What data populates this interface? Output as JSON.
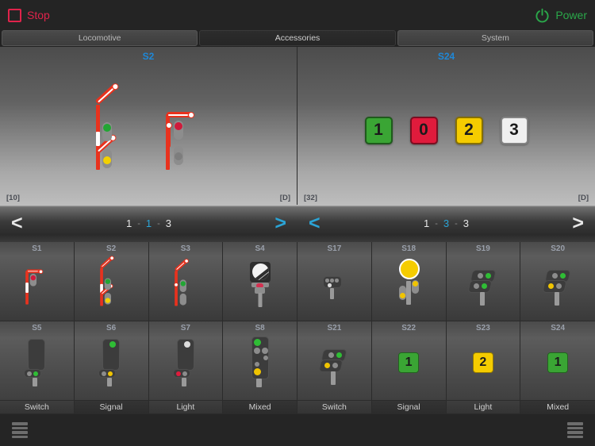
{
  "topbar": {
    "stop_label": "Stop",
    "power_label": "Power",
    "stop_color": "#e0234b",
    "power_color": "#2aa84a"
  },
  "tabs": [
    {
      "label": "Locomotive",
      "active": false
    },
    {
      "label": "Accessories",
      "active": true
    },
    {
      "label": "System",
      "active": false
    }
  ],
  "panels": [
    {
      "title": "S2",
      "corner_left": "[10]",
      "corner_right": "[D]",
      "type": "semaphore"
    },
    {
      "title": "S24",
      "corner_left": "[32]",
      "corner_right": "[D]",
      "type": "plates",
      "plates": [
        {
          "value": "1",
          "color": "#3aa534"
        },
        {
          "value": "0",
          "color": "#e01b3c"
        },
        {
          "value": "2",
          "color": "#f5cc00"
        },
        {
          "value": "3",
          "color": "#f0f0f0"
        }
      ]
    }
  ],
  "nav": {
    "left": {
      "prev": "<",
      "next": ">",
      "first": "1",
      "current": "1",
      "last": "3",
      "sep": "-"
    },
    "right": {
      "prev": "<",
      "next": ">",
      "first": "1",
      "current": "3",
      "last": "3",
      "sep": "-"
    }
  },
  "grid": {
    "row1": [
      {
        "id": "S1",
        "art": "sema-1"
      },
      {
        "id": "S2",
        "art": "sema-2"
      },
      {
        "id": "S3",
        "art": "sema-3"
      },
      {
        "id": "S4",
        "art": "sign-round"
      },
      {
        "id": "S17",
        "art": "dwarf-small"
      },
      {
        "id": "S18",
        "art": "big-yellow",
        "selected": true
      },
      {
        "id": "S19",
        "art": "dwarf-green"
      },
      {
        "id": "S20",
        "art": "dwarf-yellow"
      }
    ],
    "row2": [
      {
        "id": "S5",
        "art": "box-blank",
        "foot": "Switch"
      },
      {
        "id": "S6",
        "art": "box-green-yellow",
        "foot": "Signal"
      },
      {
        "id": "S7",
        "art": "box-white-red",
        "foot": "Light"
      },
      {
        "id": "S8",
        "art": "box-mixed",
        "foot": "Mixed"
      },
      {
        "id": "S21",
        "art": "dwarf-yellow2",
        "foot": "Switch"
      },
      {
        "id": "S22",
        "art": "plate-green-1",
        "foot": "Signal"
      },
      {
        "id": "S23",
        "art": "plate-yellow-2",
        "foot": "Light"
      },
      {
        "id": "S24",
        "art": "plate-green-1b",
        "foot": "Mixed"
      }
    ]
  },
  "bottombar": {
    "left_icon": "grid-list-icon",
    "right_icon": "grid-list-icon"
  }
}
